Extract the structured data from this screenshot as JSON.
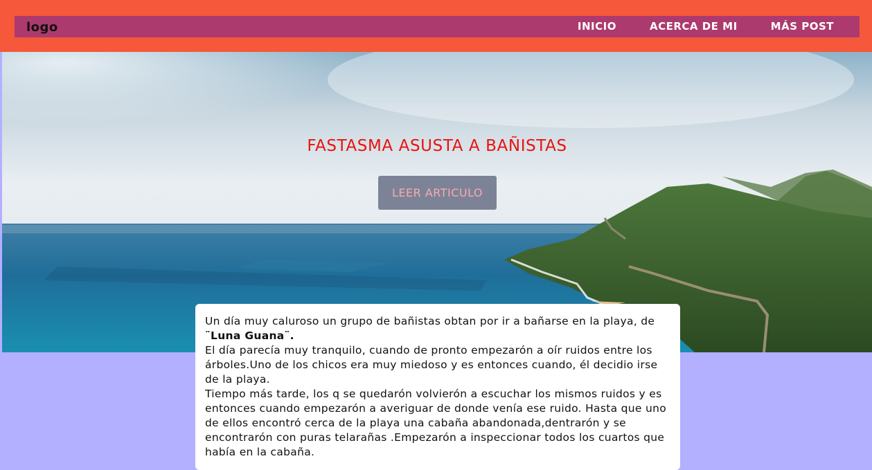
{
  "header": {
    "logo": "logo",
    "nav": [
      {
        "label": "INICIO"
      },
      {
        "label": "ACERCA DE MI"
      },
      {
        "label": "MÁS POST"
      }
    ]
  },
  "hero": {
    "title": "FASTASMA ASUSTA A BAÑISTAS",
    "button_label": "LEER ARTICULO"
  },
  "article": {
    "p1_text": "Un día muy caluroso un grupo de bañistas obtan por ir a bañarse en la playa, de ",
    "p1_bold": "¨Luna Guana¨.",
    "p2": "El día parecía muy tranquilo, cuando de pronto empezarón a oír ruidos entre los árboles.Uno de los chicos era muy miedoso y es entonces cuando, él decidio irse de la playa.",
    "p3": "Tiempo más tarde, los q se quedarón volvierón a escuchar los mismos ruidos y es entonces cuando empezarón a averiguar de donde venía ese ruido. Hasta que uno de ellos encontró cerca de la playa una cabaña abandonada,dentrarón y se encontrarón con puras telarañas .Empezarón a inspeccionar todos los cuartos que había en la cabaña."
  },
  "colors": {
    "header_bg": "#f5583a",
    "navbar_bg": "#ad3a6e",
    "page_bg": "#b2b0ff",
    "title_color": "#e8120f",
    "button_bg": "#7d8396",
    "button_text": "#f8aab0"
  }
}
